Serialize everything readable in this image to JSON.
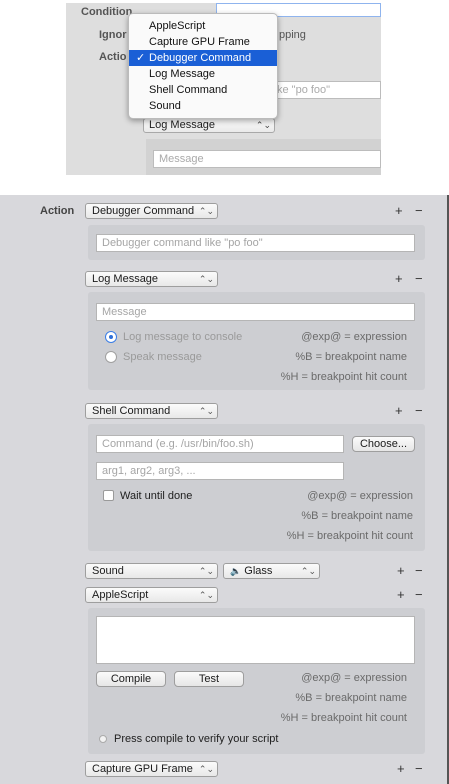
{
  "inset": {
    "condition_label": "Condition",
    "ignore_label": "Ignor",
    "ignore_suffix": "pping",
    "action_label": "Actio",
    "menu_items": [
      {
        "label": "AppleScript",
        "selected": false
      },
      {
        "label": "Capture GPU Frame",
        "selected": false
      },
      {
        "label": "Debugger Command",
        "selected": true
      },
      {
        "label": "Log Message",
        "selected": false
      },
      {
        "label": "Shell Command",
        "selected": false
      },
      {
        "label": "Sound",
        "selected": false
      }
    ],
    "checkmark": "✓",
    "partial_placeholder": "ke \"po foo\"",
    "log_popup": "Log Message",
    "message_placeholder": "Message"
  },
  "panel": {
    "action_label": "Action",
    "plus": "+",
    "minus": "−",
    "chevron": "⌃⌄",
    "debugger": {
      "popup": "Debugger Command",
      "placeholder": "Debugger command like \"po foo\""
    },
    "log": {
      "popup": "Log Message",
      "placeholder": "Message",
      "radio_console": "Log message to console",
      "radio_speak": "Speak message",
      "hint_exp": "@exp@ = expression",
      "hint_b": "%B = breakpoint name",
      "hint_h": "%H = breakpoint hit count"
    },
    "shell": {
      "popup": "Shell Command",
      "command_placeholder": "Command (e.g. /usr/bin/foo.sh)",
      "choose_button": "Choose...",
      "args_placeholder": "arg1, arg2, arg3, ...",
      "wait_label": "Wait until done",
      "hint_exp": "@exp@ = expression",
      "hint_b": "%B = breakpoint name",
      "hint_h": "%H = breakpoint hit count"
    },
    "sound": {
      "popup": "Sound",
      "sound_icon": "🔈",
      "value": "Glass"
    },
    "applescript": {
      "popup": "AppleScript",
      "compile_button": "Compile",
      "test_button": "Test",
      "hint_exp": "@exp@ = expression",
      "hint_b": "%B = breakpoint name",
      "hint_h": "%H = breakpoint hit count",
      "status": "Press compile to verify your script"
    },
    "gpu": {
      "popup": "Capture GPU Frame"
    }
  }
}
